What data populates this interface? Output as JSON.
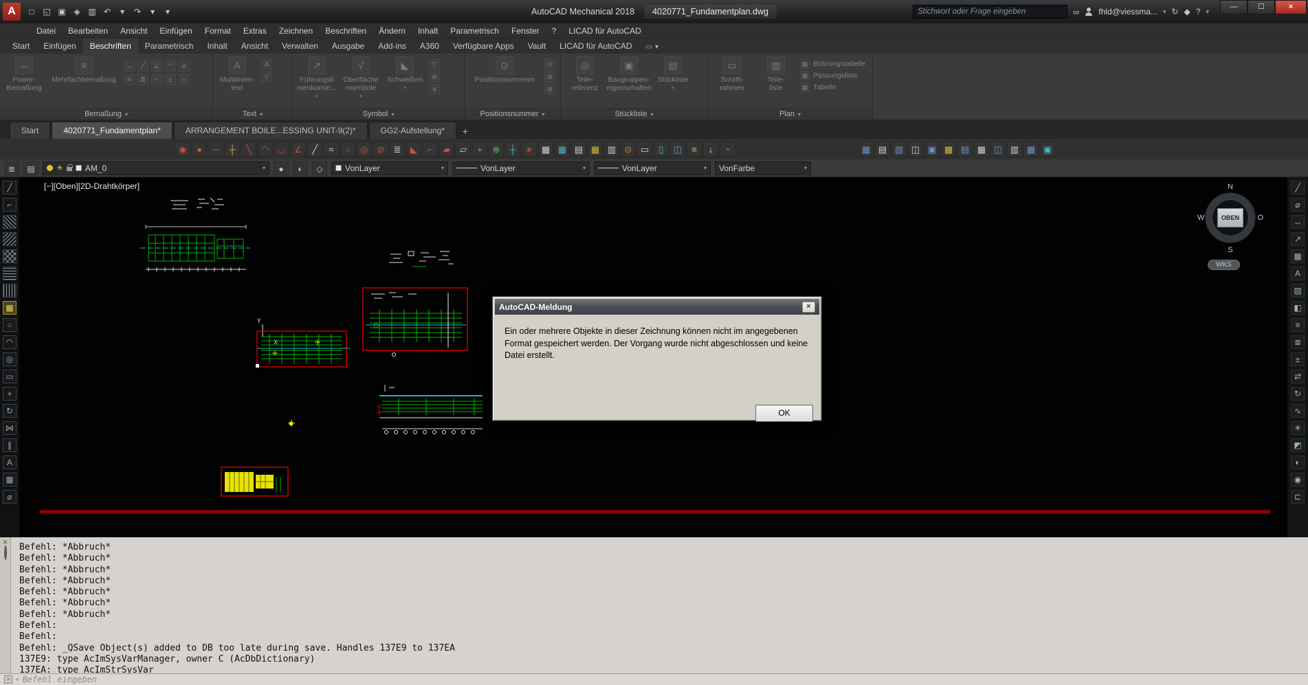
{
  "titlebar": {
    "logo_letter": "A",
    "app_title": "AutoCAD Mechanical 2018",
    "doc_title": "4020771_Fundamentplan.dwg",
    "search_placeholder": "Stichwort oder Frage eingeben",
    "account": "fhld@viessma...",
    "minimize_label": "—",
    "maximize_label": "☐",
    "close_label": "×",
    "help_label": "?",
    "qat_icons": [
      {
        "name": "new-file-icon",
        "glyph": "□"
      },
      {
        "name": "open-file-icon",
        "glyph": "◱"
      },
      {
        "name": "save-icon",
        "glyph": "▣"
      },
      {
        "name": "save-as-icon",
        "glyph": "◈"
      },
      {
        "name": "plot-icon",
        "glyph": "▥"
      },
      {
        "name": "undo-icon",
        "glyph": "↶"
      },
      {
        "name": "undo-caret-icon",
        "glyph": "▾"
      },
      {
        "name": "redo-icon",
        "glyph": "↷"
      },
      {
        "name": "redo-caret-icon",
        "glyph": "▾"
      },
      {
        "name": "qat-customize-icon",
        "glyph": "▾"
      }
    ]
  },
  "menubar": {
    "items": [
      "Datei",
      "Bearbeiten",
      "Ansicht",
      "Einfügen",
      "Format",
      "Extras",
      "Zeichnen",
      "Beschriften",
      "Ändern",
      "Inhalt",
      "Parametrisch",
      "Fenster",
      "?",
      "LICAD für AutoCAD"
    ]
  },
  "ribbon": {
    "active_tab": 2,
    "tabs": [
      "Start",
      "Einfügen",
      "Beschriften",
      "Parametrisch",
      "Inhalt",
      "Ansicht",
      "Verwalten",
      "Ausgabe",
      "Add-ins",
      "A360",
      "Verfügbare Apps",
      "Vault",
      "LICAD für AutoCAD"
    ],
    "panels": [
      {
        "label": "Bemaßung",
        "buttons": [
          {
            "label": "Power-\nBemaßung",
            "glyph": "↔"
          },
          {
            "label": "Mehrfachbemaßung",
            "glyph": "≡",
            "wide": true
          }
        ],
        "grid_icons": [
          {
            "name": "linear-dim-icon",
            "glyph": "↔"
          },
          {
            "name": "aligned-dim-icon",
            "glyph": "╱"
          },
          {
            "name": "angular-dim-icon",
            "glyph": "∠"
          },
          {
            "name": "radius-dim-icon",
            "glyph": "◠"
          },
          {
            "name": "diameter-dim-icon",
            "glyph": "⌀"
          },
          {
            "name": "baseline-dim-icon",
            "glyph": "≡"
          },
          {
            "name": "chain-dim-icon",
            "glyph": "≣"
          },
          {
            "name": "ordinate-dim-icon",
            "glyph": "⊢"
          },
          {
            "name": "tolerance-dim-icon",
            "glyph": "±"
          },
          {
            "name": "dim-break-icon",
            "glyph": "≈"
          }
        ]
      },
      {
        "label": "Text",
        "buttons": [
          {
            "label": "Multilinien-\ntext",
            "glyph": "A"
          }
        ],
        "side_icons": [
          {
            "name": "single-line-text-icon",
            "glyph": "A"
          },
          {
            "name": "spell-check-icon",
            "glyph": "√"
          }
        ]
      },
      {
        "label": "Symbol",
        "buttons": [
          {
            "label": "Führungsli\nnienkomm...",
            "glyph": "↗",
            "arrow": true
          },
          {
            "label": "Oberfläche\nnsymbole",
            "glyph": "√",
            "arrow": true
          },
          {
            "label": "Schweißen",
            "glyph": "◣",
            "arrow": true
          }
        ],
        "side_icons": [
          {
            "name": "datum-identifier-icon",
            "glyph": "▽"
          },
          {
            "name": "feature-control-frame-icon",
            "glyph": "⊕"
          },
          {
            "name": "edge-symbol-icon",
            "glyph": "∨"
          }
        ]
      },
      {
        "label": "Positionsnummer",
        "buttons": [
          {
            "label": "Positionsnummern",
            "glyph": "⊙",
            "wide": true
          }
        ],
        "side_icons": [
          {
            "name": "balloon-add-icon",
            "glyph": "⊙"
          },
          {
            "name": "balloon-collect-icon",
            "glyph": "⊚"
          },
          {
            "name": "balloon-renumber-icon",
            "glyph": "⊛"
          }
        ]
      },
      {
        "label": "Stückliste",
        "buttons": [
          {
            "label": "Teile-\nreferenz",
            "glyph": "◎"
          },
          {
            "label": "Baugruppen-\neigenschaften",
            "glyph": "▣"
          },
          {
            "label": "Stückliste",
            "glyph": "▤",
            "arrow": true
          }
        ]
      },
      {
        "label": "Plan",
        "buttons": [
          {
            "label": "Schrift-\nrahmen",
            "glyph": "▭"
          },
          {
            "label": "Teile-\nliste",
            "glyph": "▥"
          }
        ],
        "list_buttons": [
          "Bohrungstabelle",
          "Passungsliste",
          "Tabelle"
        ]
      }
    ],
    "collapse_icon": "▭",
    "collapse_caret": "▾"
  },
  "file_tabs": {
    "tabs": [
      {
        "label": "Start",
        "active": false
      },
      {
        "label": "4020771_Fundamentplan*",
        "active": true
      },
      {
        "label": "ARRANGEMENT BOILE...ESSING UNIT-9(2)*",
        "active": false
      },
      {
        "label": "GG2-Aufstellung*",
        "active": false
      }
    ],
    "new_tab_label": "+"
  },
  "toolbar": {
    "groups": [
      [
        {
          "name": "power-snap-icon",
          "glyph": "◉",
          "color": "#cf5036"
        },
        {
          "name": "point-style-icon",
          "glyph": "●",
          "color": "#cf5036"
        },
        {
          "name": "centerline-icon",
          "glyph": "─",
          "color": "#cf5036"
        },
        {
          "name": "centermark-icon",
          "glyph": "┼",
          "color": "#d8b832"
        },
        {
          "name": "section-line-icon",
          "glyph": "╲",
          "color": "#cf5036"
        },
        {
          "name": "arc-top-icon",
          "glyph": "◠",
          "color": "#cf5036"
        },
        {
          "name": "arc-bottom-icon",
          "glyph": "◡",
          "color": "#cf5036"
        },
        {
          "name": "angle-dimension-icon",
          "glyph": "∠",
          "color": "#cf5036"
        },
        {
          "name": "construction-line-icon",
          "glyph": "╱",
          "color": "#cfcfcf"
        },
        {
          "name": "break-symbol-icon",
          "glyph": "≈",
          "color": "#cfcfcf"
        },
        {
          "name": "hole-circle-icon",
          "glyph": "○",
          "color": "#cf5036"
        },
        {
          "name": "bolt-circle-icon",
          "glyph": "◎",
          "color": "#cf5036"
        },
        {
          "name": "hidden-edge-icon",
          "glyph": "⊘",
          "color": "#cf5036"
        },
        {
          "name": "thread-lines-icon",
          "glyph": "≣",
          "color": "#cfcfcf"
        },
        {
          "name": "chamfer-icon",
          "glyph": "◣",
          "color": "#cf5036"
        },
        {
          "name": "fillet-icon",
          "glyph": "⌐",
          "color": "#cf5036"
        },
        {
          "name": "hatch-tool-icon",
          "glyph": "▰",
          "color": "#cf5036"
        },
        {
          "name": "erase-symbol-icon",
          "glyph": "▱",
          "color": "#cfcfcf"
        },
        {
          "name": "add-object-icon",
          "glyph": "+",
          "color": "#58b858"
        },
        {
          "name": "power-edit-icon",
          "glyph": "⊕",
          "color": "#58b858"
        },
        {
          "name": "snap-target-icon",
          "glyph": "┼",
          "color": "#45b7c7"
        },
        {
          "name": "star-tool-icon",
          "glyph": "∗",
          "color": "#cf5036"
        },
        {
          "name": "table-tool-icon",
          "glyph": "▦",
          "color": "#cfcfcf"
        },
        {
          "name": "bom-table-icon",
          "glyph": "▦",
          "color": "#45b7c7"
        },
        {
          "name": "parts-list-icon",
          "glyph": "▤",
          "color": "#cfcfcf"
        },
        {
          "name": "revision-table-icon",
          "glyph": "▦",
          "color": "#d8b832"
        },
        {
          "name": "title-border-icon",
          "glyph": "▥",
          "color": "#cfcfcf"
        },
        {
          "name": "balloon-tool-icon",
          "glyph": "⊙",
          "color": "#d88a32"
        },
        {
          "name": "frame-tool-icon",
          "glyph": "▭",
          "color": "#cfcfcf"
        },
        {
          "name": "drawing-sheet-icon",
          "glyph": "▯",
          "color": "#45b7c7"
        },
        {
          "name": "zone-marker-icon",
          "glyph": "◫",
          "color": "#6a93cf"
        },
        {
          "name": "layer-group-icon",
          "glyph": "≡",
          "color": "#d8b832"
        },
        {
          "name": "export-table-icon",
          "glyph": "↓",
          "color": "#cfcfcf"
        },
        {
          "name": "annotation-view-icon",
          "glyph": "◔",
          "color": "#cf5036"
        }
      ],
      [
        {
          "name": "table-style-1-icon",
          "glyph": "▦",
          "color": "#6a93cf"
        },
        {
          "name": "table-style-2-icon",
          "glyph": "▤",
          "color": "#cfcfcf"
        },
        {
          "name": "table-style-3-icon",
          "glyph": "▥",
          "color": "#6a93cf"
        },
        {
          "name": "table-style-4-icon",
          "glyph": "◫",
          "color": "#cfcfcf"
        },
        {
          "name": "table-style-5-icon",
          "glyph": "▣",
          "color": "#6a93cf"
        },
        {
          "name": "table-style-6-icon",
          "glyph": "▦",
          "color": "#d8b832"
        },
        {
          "name": "table-style-7-icon",
          "glyph": "▤",
          "color": "#6a93cf"
        },
        {
          "name": "table-style-8-icon",
          "glyph": "▦",
          "color": "#cfcfcf"
        },
        {
          "name": "table-style-9-icon",
          "glyph": "◫",
          "color": "#6a93cf"
        },
        {
          "name": "table-style-10-icon",
          "glyph": "▥",
          "color": "#cfcfcf"
        },
        {
          "name": "table-style-11-icon",
          "glyph": "▦",
          "color": "#6a93cf"
        },
        {
          "name": "table-style-12-icon",
          "glyph": "▣",
          "color": "#45b7c7"
        }
      ]
    ]
  },
  "properties_bar": {
    "layer_value": "AM_0",
    "color_value": "VonLayer",
    "linetype_value": "VonLayer",
    "lineweight_value": "VonLayer",
    "plotstyle_value": "VonFarbe"
  },
  "left_toolbar": {
    "icons": [
      {
        "name": "line-tool-icon",
        "glyph": "╱"
      },
      {
        "name": "polyline-tool-icon",
        "glyph": "⌐"
      },
      {
        "name": "hatch-ansi31-icon",
        "pattern": "p-h45"
      },
      {
        "name": "hatch-ansi37-icon",
        "pattern": "p-h135"
      },
      {
        "name": "hatch-cross-icon",
        "pattern": "p-hx"
      },
      {
        "name": "hatch-horizontal-icon",
        "pattern": "p-hh"
      },
      {
        "name": "hatch-vertical-icon",
        "pattern": "p-hv"
      },
      {
        "name": "layer-tool-icon",
        "glyph": "▦",
        "active": true
      },
      {
        "name": "circle-tool-icon",
        "glyph": "○"
      },
      {
        "name": "arc-tool-icon",
        "glyph": "◠"
      },
      {
        "name": "ellipse-tool-icon",
        "glyph": "◎"
      },
      {
        "name": "rectangle-tool-icon",
        "glyph": "▭"
      },
      {
        "name": "move-tool-icon",
        "glyph": "+"
      },
      {
        "name": "rotate-tool-icon",
        "glyph": "↻"
      },
      {
        "name": "mirror-tool-icon",
        "glyph": "⋈"
      },
      {
        "name": "offset-tool-icon",
        "glyph": "∥"
      },
      {
        "name": "text-tool-icon",
        "glyph": "A"
      },
      {
        "name": "table-tool-icon",
        "glyph": "▦"
      },
      {
        "name": "measure-tool-icon",
        "glyph": "⌀"
      }
    ]
  },
  "right_toolbar": {
    "icons": [
      {
        "name": "edit-markup-icon",
        "glyph": "╱"
      },
      {
        "name": "measure-icon",
        "glyph": "⌀"
      },
      {
        "name": "dimension-icon",
        "glyph": "↔"
      },
      {
        "name": "leader-icon",
        "glyph": "↗"
      },
      {
        "name": "table-icon",
        "glyph": "▦"
      },
      {
        "name": "text-icon",
        "glyph": "A"
      },
      {
        "name": "hatch-icon",
        "glyph": "▨"
      },
      {
        "name": "block-icon",
        "glyph": "◧"
      },
      {
        "name": "layers-icon",
        "glyph": "≡"
      },
      {
        "name": "properties-icon",
        "glyph": "≣"
      },
      {
        "name": "zoom-icon",
        "glyph": "±"
      },
      {
        "name": "pan-icon",
        "glyph": "⇄"
      },
      {
        "name": "orbit-icon",
        "glyph": "↻"
      },
      {
        "name": "section-icon",
        "glyph": "∿"
      },
      {
        "name": "sun-study-icon",
        "glyph": "☀"
      },
      {
        "name": "materials-icon",
        "glyph": "◩"
      },
      {
        "name": "render-icon",
        "glyph": "◐"
      },
      {
        "name": "camera-icon",
        "glyph": "◉"
      },
      {
        "name": "clip-icon",
        "glyph": "⊏"
      }
    ]
  },
  "viewport": {
    "controls_label": "[−][Oben][2D-Drahtkörper]",
    "viewcube": {
      "n": "N",
      "s": "S",
      "w": "W",
      "o": "O",
      "face": "OBEN",
      "wks": "WKS"
    }
  },
  "dialog": {
    "title": "AutoCAD-Meldung",
    "close_label": "×",
    "message": "Ein oder mehrere Objekte in dieser Zeichnung können nicht im angegebenen Format gespeichert werden. Der Vorgang wurde nicht abgeschlossen und keine Datei erstellt.",
    "ok_label": "OK"
  },
  "command": {
    "history": [
      "Befehl: *Abbruch*",
      "Befehl: *Abbruch*",
      "Befehl: *Abbruch*",
      "Befehl: *Abbruch*",
      "Befehl: *Abbruch*",
      "Befehl: *Abbruch*",
      "Befehl: *Abbruch*",
      "Befehl:",
      "Befehl:",
      "Befehl: _QSave Object(s) added to DB too late during save. Handles 137E9 to 137EA",
      "137E9: type AcImSysVarManager, owner C (AcDbDictionary)",
      "137EA: type AcImStrSysVar"
    ],
    "input_placeholder": "Befehl eingeben",
    "prompt_icon": ">",
    "caret": "▾"
  }
}
